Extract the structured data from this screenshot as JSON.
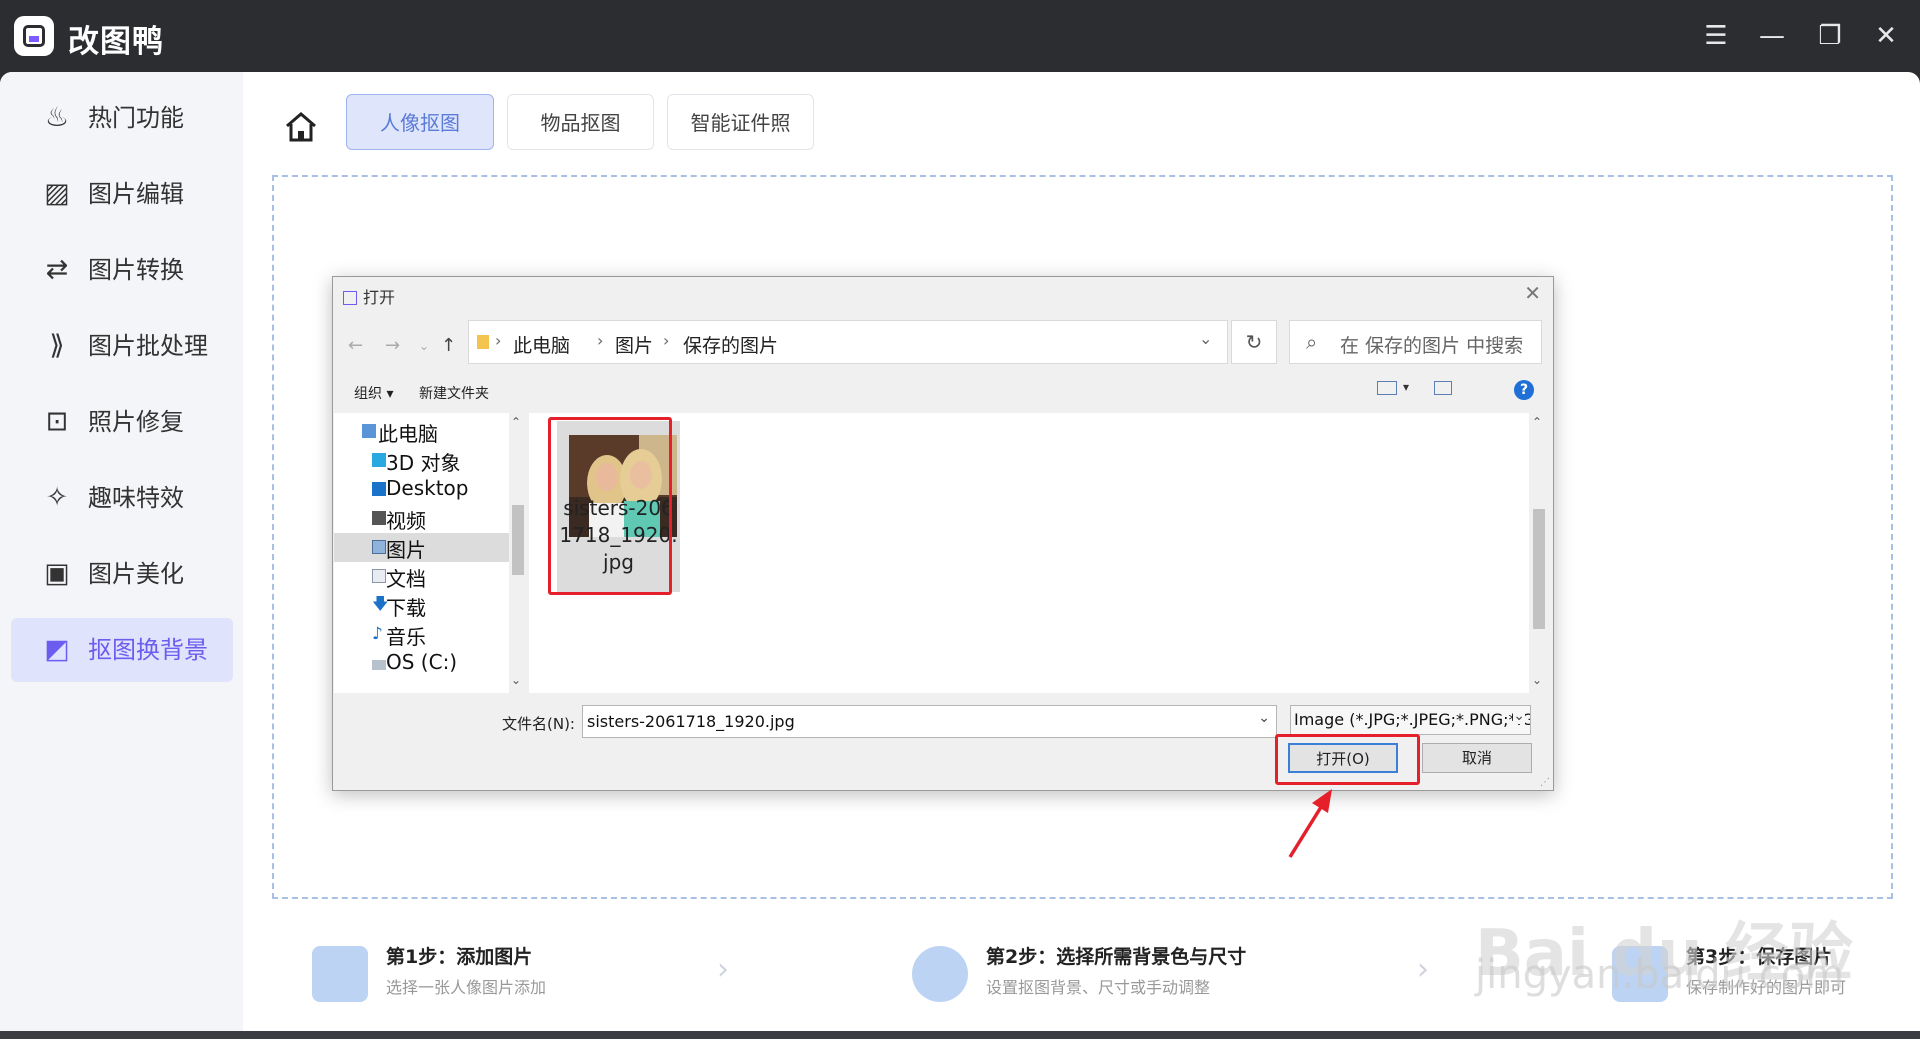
{
  "app": {
    "title": "改图鸭",
    "window_controls": [
      "menu-icon",
      "minimize-icon",
      "maximize-icon",
      "close-icon"
    ]
  },
  "sidebar": {
    "items": [
      {
        "label": "热门功能",
        "icon": "fire-icon"
      },
      {
        "label": "图片编辑",
        "icon": "image-edit-icon"
      },
      {
        "label": "图片转换",
        "icon": "convert-icon"
      },
      {
        "label": "图片批处理",
        "icon": "batch-icon"
      },
      {
        "label": "照片修复",
        "icon": "repair-icon"
      },
      {
        "label": "趣味特效",
        "icon": "sparkle-icon"
      },
      {
        "label": "图片美化",
        "icon": "beautify-icon"
      },
      {
        "label": "抠图换背景",
        "icon": "cutout-icon",
        "active": true
      }
    ]
  },
  "tabs": [
    {
      "label": "人像抠图",
      "active": true
    },
    {
      "label": "物品抠图"
    },
    {
      "label": "智能证件照"
    }
  ],
  "steps": [
    {
      "title": "第1步：添加图片",
      "desc": "选择一张人像图片添加"
    },
    {
      "title": "第2步：选择所需背景色与尺寸",
      "desc": "设置抠图背景、尺寸或手动调整"
    },
    {
      "title": "第3步：保存图片",
      "desc": "保存制作好的图片即可"
    }
  ],
  "dialog": {
    "title": "打开",
    "breadcrumb": [
      "此电脑",
      "图片",
      "保存的图片"
    ],
    "search_placeholder": "在 保存的图片 中搜索",
    "toolbar": {
      "organize": "组织 ▾",
      "new_folder": "新建文件夹"
    },
    "tree": [
      {
        "label": "此电脑",
        "icon": "computer-icon"
      },
      {
        "label": "3D 对象",
        "icon": "3d-objects-icon"
      },
      {
        "label": "Desktop",
        "icon": "desktop-icon"
      },
      {
        "label": "视频",
        "icon": "video-icon"
      },
      {
        "label": "图片",
        "icon": "pictures-icon",
        "selected": true
      },
      {
        "label": "文档",
        "icon": "documents-icon"
      },
      {
        "label": "下载",
        "icon": "download-icon"
      },
      {
        "label": "音乐",
        "icon": "music-icon"
      },
      {
        "label": "OS (C:)",
        "icon": "drive-icon"
      }
    ],
    "file": {
      "name_line1": "sisters-206",
      "name_line2": "1718_1920.",
      "name_line3": "jpg"
    },
    "filename_label": "文件名(N):",
    "filename_value": "sisters-2061718_1920.jpg",
    "filter_value": "Image (*.JPG;*.JPEG;*.PNG;*.G",
    "open_button": "打开(O)",
    "cancel_button": "取消"
  },
  "watermark": {
    "line1": "Bai du 经验",
    "line2": "jingyan.baidu.com"
  },
  "colors": {
    "accent": "#6d5cf0",
    "highlight": "#e5202b",
    "dropzone_border": "#a8c0e6"
  }
}
